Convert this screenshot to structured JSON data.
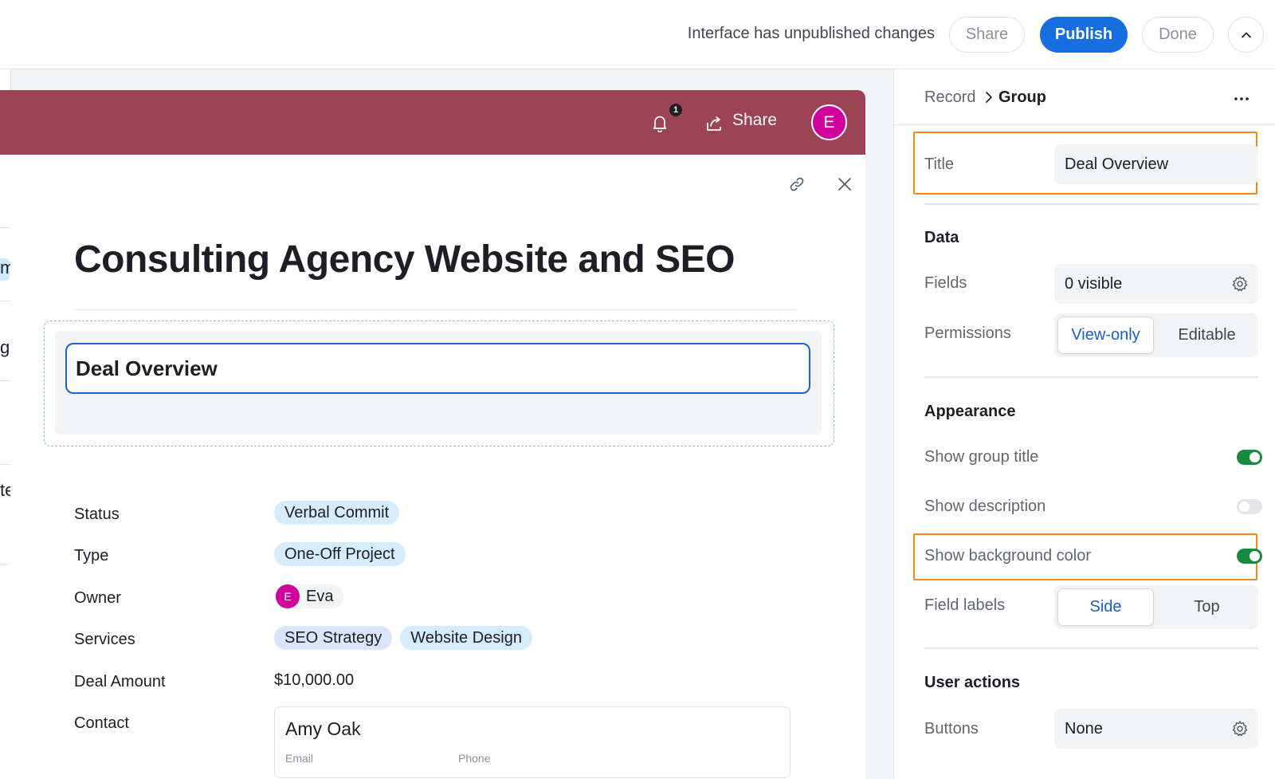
{
  "topbar": {
    "status_text": "Interface has unpublished changes",
    "share_label": "Share",
    "publish_label": "Publish",
    "done_label": "Done",
    "colors": {
      "publish_bg": "#166ee1"
    }
  },
  "background": {
    "fragments": [
      "m",
      "g",
      "te"
    ]
  },
  "appbar": {
    "notification_count": "1",
    "share_label": "Share",
    "avatar_initial": "E",
    "colors": {
      "bar": "#9c4456",
      "avatar": "#d1009d"
    }
  },
  "record": {
    "title": "Consulting Agency Website and SEO",
    "group_title": "Deal Overview",
    "fields": [
      {
        "label": "Status",
        "values": [
          "Verbal Commit"
        ]
      },
      {
        "label": "Type",
        "values": [
          "One-Off Project"
        ]
      },
      {
        "label": "Owner",
        "initial": "E",
        "name": "Eva"
      },
      {
        "label": "Services",
        "values": [
          "SEO Strategy",
          "Website Design"
        ]
      },
      {
        "label": "Deal Amount",
        "value": "$10,000.00"
      },
      {
        "label": "Contact",
        "contact_name": "Amy Oak",
        "contact_sub": [
          "Email",
          "Phone"
        ]
      }
    ]
  },
  "config": {
    "breadcrumb": {
      "parent": "Record",
      "current": "Group"
    },
    "title_label": "Title",
    "title_value": "Deal Overview",
    "data_heading": "Data",
    "fields_label": "Fields",
    "fields_value": "0 visible",
    "permissions_label": "Permissions",
    "permissions_options": [
      "View-only",
      "Editable"
    ],
    "permissions_selected": "View-only",
    "appearance_heading": "Appearance",
    "show_group_title": {
      "label": "Show group title",
      "on": true
    },
    "show_description": {
      "label": "Show description",
      "on": false
    },
    "show_background_color": {
      "label": "Show background color",
      "on": true
    },
    "field_labels_label": "Field labels",
    "field_labels_options": [
      "Side",
      "Top"
    ],
    "field_labels_selected": "Side",
    "user_actions_heading": "User actions",
    "buttons_label": "Buttons",
    "buttons_value": "None",
    "colors": {
      "highlight": "#f08a1a",
      "toggle_on": "#178a3f"
    }
  }
}
